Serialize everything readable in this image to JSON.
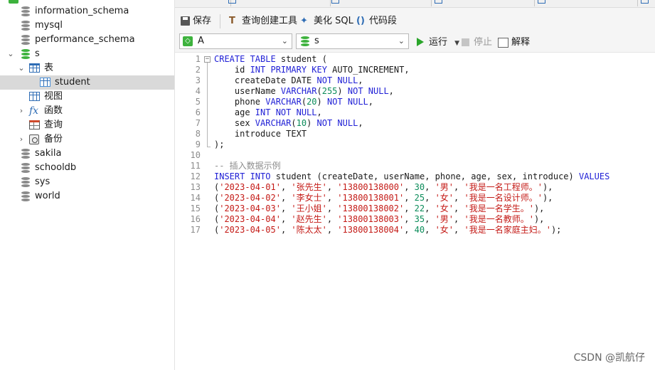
{
  "sidebar": {
    "items": [
      {
        "label": "information_schema"
      },
      {
        "label": "mysql"
      },
      {
        "label": "performance_schema"
      },
      {
        "label": "s"
      },
      {
        "label": "表"
      },
      {
        "label": "student"
      },
      {
        "label": "视图"
      },
      {
        "label": "函数"
      },
      {
        "label": "查询"
      },
      {
        "label": "备份"
      },
      {
        "label": "sakila"
      },
      {
        "label": "schooldb"
      },
      {
        "label": "sys"
      },
      {
        "label": "world"
      }
    ]
  },
  "toolbar": {
    "save_label": "保存",
    "query_builder_label": "查询创建工具",
    "beautify_label": "美化 SQL",
    "snippet_label": "代码段"
  },
  "selectors": {
    "connection_value": "A",
    "database_value": "s",
    "run_label": "运行",
    "stop_label": "停止",
    "explain_label": "解释"
  },
  "editor": {
    "line_numbers": [
      "1",
      "2",
      "3",
      "4",
      "5",
      "6",
      "7",
      "8",
      "9",
      "10",
      "11",
      "12",
      "13",
      "14",
      "15",
      "16",
      "17"
    ],
    "lines": [
      [
        [
          "kw",
          "CREATE TABLE"
        ],
        [
          "t",
          " student ("
        ]
      ],
      [
        [
          "t",
          "    id "
        ],
        [
          "kw",
          "INT PRIMARY KEY"
        ],
        [
          "t",
          " AUTO_INCREMENT,"
        ]
      ],
      [
        [
          "t",
          "    createDate DATE "
        ],
        [
          "kw",
          "NOT NULL"
        ],
        [
          "t",
          ","
        ]
      ],
      [
        [
          "t",
          "    userName "
        ],
        [
          "kw",
          "VARCHAR"
        ],
        [
          "t",
          "("
        ],
        [
          "num",
          "255"
        ],
        [
          "t",
          ") "
        ],
        [
          "kw",
          "NOT NULL"
        ],
        [
          "t",
          ","
        ]
      ],
      [
        [
          "t",
          "    phone "
        ],
        [
          "kw",
          "VARCHAR"
        ],
        [
          "t",
          "("
        ],
        [
          "num",
          "20"
        ],
        [
          "t",
          ") "
        ],
        [
          "kw",
          "NOT NULL"
        ],
        [
          "t",
          ","
        ]
      ],
      [
        [
          "t",
          "    age "
        ],
        [
          "kw",
          "INT NOT NULL"
        ],
        [
          "t",
          ","
        ]
      ],
      [
        [
          "t",
          "    sex "
        ],
        [
          "kw",
          "VARCHAR"
        ],
        [
          "t",
          "("
        ],
        [
          "num",
          "10"
        ],
        [
          "t",
          ") "
        ],
        [
          "kw",
          "NOT NULL"
        ],
        [
          "t",
          ","
        ]
      ],
      [
        [
          "t",
          "    introduce TEXT"
        ]
      ],
      [
        [
          "t",
          ");"
        ]
      ],
      [
        [
          "t",
          ""
        ]
      ],
      [
        [
          "cmt",
          "-- 插入数据示例"
        ]
      ],
      [
        [
          "kw",
          "INSERT INTO"
        ],
        [
          "t",
          " student (createDate, userName, phone, age, sex, introduce) "
        ],
        [
          "kw",
          "VALUES"
        ]
      ],
      [
        [
          "t",
          "("
        ],
        [
          "str",
          "'2023-04-01'"
        ],
        [
          "t",
          ", "
        ],
        [
          "str",
          "'张先生'"
        ],
        [
          "t",
          ", "
        ],
        [
          "str",
          "'13800138000'"
        ],
        [
          "t",
          ", "
        ],
        [
          "num",
          "30"
        ],
        [
          "t",
          ", "
        ],
        [
          "str",
          "'男'"
        ],
        [
          "t",
          ", "
        ],
        [
          "str",
          "'我是一名工程师。'"
        ],
        [
          "t",
          "),"
        ]
      ],
      [
        [
          "t",
          "("
        ],
        [
          "str",
          "'2023-04-02'"
        ],
        [
          "t",
          ", "
        ],
        [
          "str",
          "'李女士'"
        ],
        [
          "t",
          ", "
        ],
        [
          "str",
          "'13800138001'"
        ],
        [
          "t",
          ", "
        ],
        [
          "num",
          "25"
        ],
        [
          "t",
          ", "
        ],
        [
          "str",
          "'女'"
        ],
        [
          "t",
          ", "
        ],
        [
          "str",
          "'我是一名设计师。'"
        ],
        [
          "t",
          "),"
        ]
      ],
      [
        [
          "t",
          "("
        ],
        [
          "str",
          "'2023-04-03'"
        ],
        [
          "t",
          ", "
        ],
        [
          "str",
          "'王小姐'"
        ],
        [
          "t",
          ", "
        ],
        [
          "str",
          "'13800138002'"
        ],
        [
          "t",
          ", "
        ],
        [
          "num",
          "22"
        ],
        [
          "t",
          ", "
        ],
        [
          "str",
          "'女'"
        ],
        [
          "t",
          ", "
        ],
        [
          "str",
          "'我是一名学生。'"
        ],
        [
          "t",
          "),"
        ]
      ],
      [
        [
          "t",
          "("
        ],
        [
          "str",
          "'2023-04-04'"
        ],
        [
          "t",
          ", "
        ],
        [
          "str",
          "'赵先生'"
        ],
        [
          "t",
          ", "
        ],
        [
          "str",
          "'13800138003'"
        ],
        [
          "t",
          ", "
        ],
        [
          "num",
          "35"
        ],
        [
          "t",
          ", "
        ],
        [
          "str",
          "'男'"
        ],
        [
          "t",
          ", "
        ],
        [
          "str",
          "'我是一名教师。'"
        ],
        [
          "t",
          "),"
        ]
      ],
      [
        [
          "t",
          "("
        ],
        [
          "str",
          "'2023-04-05'"
        ],
        [
          "t",
          ", "
        ],
        [
          "str",
          "'陈太太'"
        ],
        [
          "t",
          ", "
        ],
        [
          "str",
          "'13800138004'"
        ],
        [
          "t",
          ", "
        ],
        [
          "num",
          "40"
        ],
        [
          "t",
          ", "
        ],
        [
          "str",
          "'女'"
        ],
        [
          "t",
          ", "
        ],
        [
          "str",
          "'我是一名家庭主妇。'"
        ],
        [
          "t",
          ");"
        ]
      ]
    ]
  },
  "watermark": "CSDN @凯航仔",
  "colors": {
    "keyword": "#1f1fd6",
    "string": "#c41a16",
    "number": "#0b8c5a",
    "comment": "#8c8c8c",
    "run_icon": "#2aa52a",
    "db_active": "#3db23d"
  }
}
